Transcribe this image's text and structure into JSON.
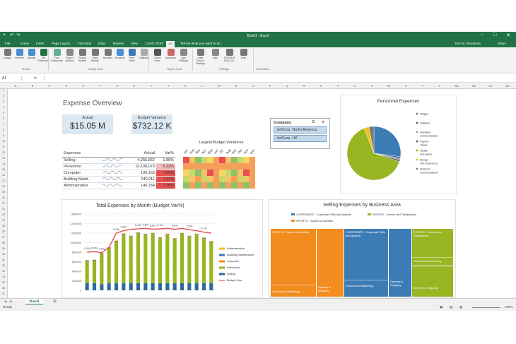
{
  "window": {
    "title": "Book1 - Excel",
    "user": "Eric M. Almadova",
    "share": "Share"
  },
  "ribbon_tabs": [
    "File",
    "Home",
    "Insert",
    "Page Layout",
    "Formulas",
    "Data",
    "Review",
    "View",
    "LOAD TEST",
    "Jet"
  ],
  "tell_me": "Tell me what you want to do...",
  "ribbon_buttons": [
    "Design",
    "Refresh",
    "Upload",
    "Jet Financials",
    "Fast Financials",
    "Report Options",
    "Report Wizard",
    "Table Builder",
    "Browser",
    "Snippets",
    "Pivot Table",
    "Drilldown",
    "Check Error",
    "Schedule",
    "App Settings",
    "Data Source Settings",
    "NAV",
    "CRONUS USA, Inc.",
    "Help"
  ],
  "ribbon_groups": [
    "Modes",
    "Design Tools",
    "Report Tools",
    "Settings",
    "Information"
  ],
  "formula_bar": {
    "name_box": "A1",
    "fx": "fx"
  },
  "columns": [
    "A",
    "B",
    "C",
    "D",
    "E",
    "F",
    "G",
    "H",
    "I",
    "J",
    "K",
    "L",
    "M",
    "N",
    "O",
    "P",
    "Q",
    "R",
    "S",
    "T",
    "U",
    "V",
    "W",
    "X",
    "Y",
    "Z",
    "AA",
    "AB",
    "AC",
    "AD"
  ],
  "dashboard": {
    "title": "Expense Overview",
    "actual_label": "Actual",
    "actual_value": "$15.05 M",
    "variance_label": "Budget Variance",
    "variance_value": "$732.12 K",
    "table_headers": [
      "Expenses",
      "",
      "Actual",
      "Var%"
    ],
    "table_rows": [
      [
        "Selling",
        "4,255,832",
        "1.86%"
      ],
      [
        "Personnel",
        "10,108,079",
        "5.33%"
      ],
      [
        "Computer",
        "199,155",
        "7.96%"
      ],
      [
        "Building Maint.",
        "240,011",
        "7.91%"
      ],
      [
        "Administrative",
        "145,334",
        "7.35%"
      ]
    ],
    "heatmap_title": "Largest Budget Variances",
    "heatmap_months": [
      "Jan",
      "Feb",
      "Mar",
      "Apr",
      "May",
      "Jun",
      "Jul",
      "Aug",
      "Sep",
      "Oct",
      "Nov",
      "Dec"
    ],
    "company_slicer": {
      "title": "Company",
      "items": [
        "JetCorp, North America",
        "JetCorp, UK"
      ]
    }
  },
  "colors": {
    "excel_green": "#217346",
    "blue": "#3c7cb5",
    "green": "#98b522",
    "orange": "#f28c1e",
    "gray": "#a5a5a5",
    "yellow": "#f2c01e"
  },
  "chart_data": [
    {
      "type": "pie",
      "title": "Personnel Expenses",
      "labels": [
        "Wages",
        "Salaries",
        "Vacation Compensation",
        "Payroll Taxes",
        "Health Insurance",
        "Group Life Insurance",
        "Workers Compensation"
      ],
      "values": [
        27,
        1,
        1,
        1,
        64,
        3,
        3
      ],
      "colors": [
        "#3c7cb5",
        "#2d6a9f",
        "#999999",
        "#555555",
        "#98b522",
        "#f2c01e",
        "#7a7a7a"
      ]
    },
    {
      "type": "bar",
      "title": "Total Expenses by Month (Budget Var%)",
      "ylim": [
        0,
        1600000
      ],
      "yticks": [
        "0",
        "200000",
        "400000",
        "600000",
        "800000",
        "1000000",
        "1200000",
        "1400000",
        "1600000"
      ],
      "months": 18,
      "series": [
        {
          "name": "Administrative",
          "values": [
            10000,
            10000,
            10000,
            10000,
            10000,
            10000,
            10000,
            10000,
            10000,
            10000,
            10000,
            10000,
            10000,
            10000,
            10000,
            10000,
            10000,
            10000
          ]
        },
        {
          "name": "Building Maintenance",
          "values": [
            15000,
            15000,
            15000,
            15000,
            15000,
            15000,
            15000,
            15000,
            15000,
            15000,
            15000,
            15000,
            15000,
            15000,
            15000,
            15000,
            15000,
            15000
          ]
        },
        {
          "name": "Computer",
          "values": [
            12000,
            12000,
            12000,
            12000,
            12000,
            12000,
            12000,
            12000,
            12000,
            12000,
            12000,
            12000,
            12000,
            12000,
            12000,
            12000,
            12000,
            12000
          ]
        },
        {
          "name": "Personnel",
          "values": [
            450000,
            460000,
            620000,
            720000,
            860000,
            1010000,
            960000,
            1030000,
            1000000,
            1020000,
            930000,
            1000000,
            910000,
            1020000,
            960000,
            1000000,
            920000,
            850000
          ]
        },
        {
          "name": "Selling",
          "values": [
            150000,
            150000,
            130000,
            150000,
            150000,
            150000,
            150000,
            150000,
            150000,
            150000,
            150000,
            150000,
            150000,
            150000,
            150000,
            150000,
            150000,
            150000
          ]
        }
      ],
      "line": {
        "name": "Budget Line",
        "values": [
          800000,
          810000,
          790000,
          900000,
          1200000,
          1250000,
          1280000,
          1290000,
          1300000,
          1280000,
          1290000,
          1300000,
          1280000,
          1300000,
          1270000,
          1250000,
          1220000,
          1200000
        ]
      },
      "annotations": [
        [
          "-0.1%",
          0
        ],
        [
          "0.9%",
          1
        ],
        [
          "0.2%",
          2
        ],
        [
          "5.4%",
          4
        ],
        [
          "5.1%",
          5
        ],
        [
          "5.4%",
          7
        ],
        [
          "4.5%",
          8
        ],
        [
          "5.8%",
          9
        ],
        [
          "5.1%",
          10
        ],
        [
          "5.8%",
          12
        ],
        [
          "5.3%",
          14
        ],
        [
          "5.1%",
          16
        ]
      ]
    },
    {
      "type": "treemap",
      "title": "Selling Expenses by Business Area",
      "legend": [
        "CORPORATE - Corporate Gifts and Awards",
        "EVENTS - Events and Tradeshows",
        "SPORTS - Sports & Activities"
      ],
      "tiles": [
        {
          "label": "SPORTS - Sports & Activities",
          "sub": "Outsourced Marketing",
          "color": "#f28c1e"
        },
        {
          "label": "",
          "sub": "Delivery & Shipping",
          "color": "#f28c1e"
        },
        {
          "label": "CORPORATE - Corporate Gifts and Awards",
          "sub": "Outsourced Marketing",
          "color": "#3c7cb5"
        },
        {
          "label": "",
          "sub": "Delivery & Shipping",
          "color": "#3c7cb5"
        },
        {
          "label": "EVENTS - Events and Tradeshows",
          "sub": "Outsourced Marketing",
          "color": "#98b522"
        },
        {
          "label": "",
          "sub": "Delivery & Shipping",
          "color": "#98b522"
        }
      ]
    }
  ],
  "sheet_tab": "Sheet1",
  "status": {
    "left": "Ready",
    "zoom": "100%"
  }
}
